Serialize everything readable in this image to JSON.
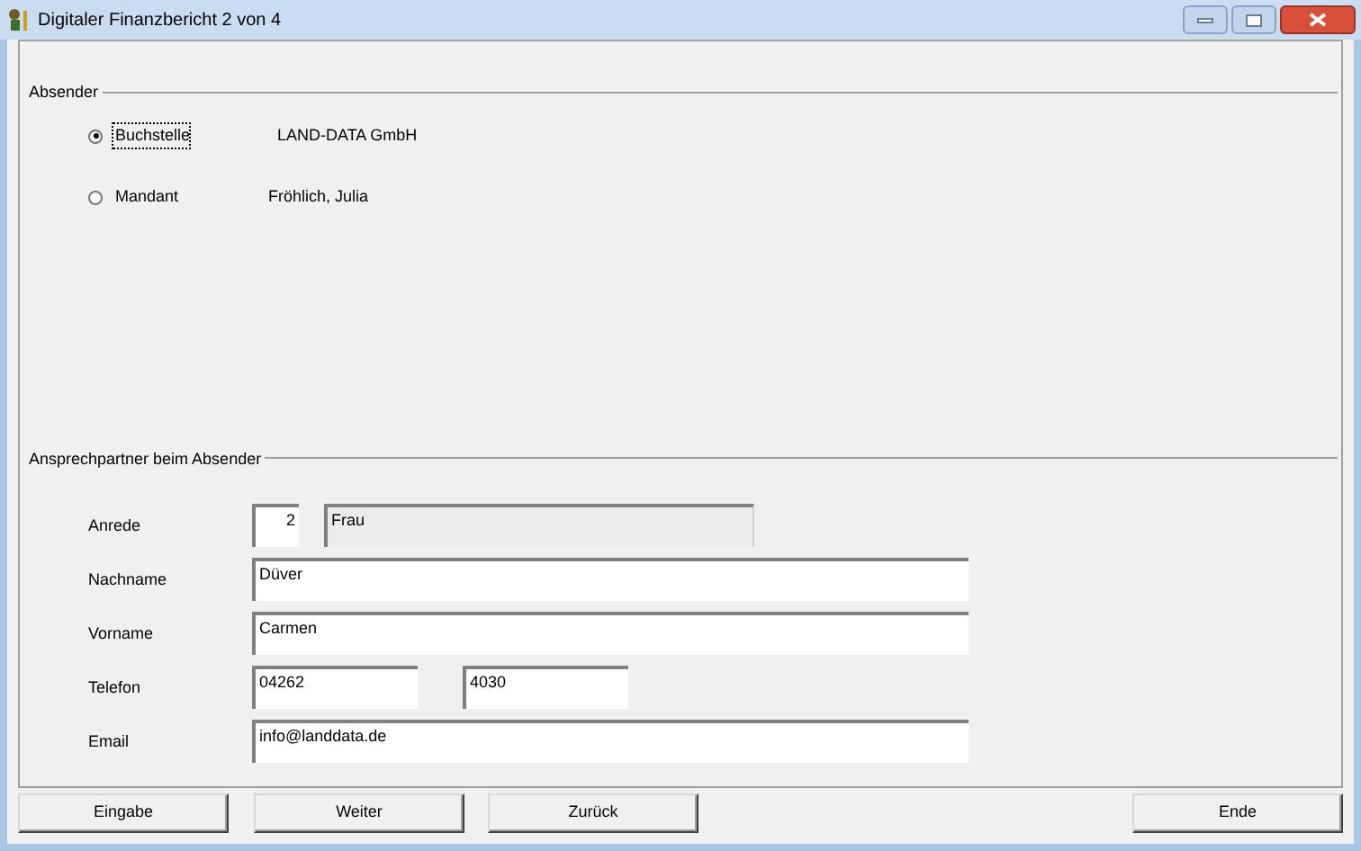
{
  "window": {
    "title": "Digitaler Finanzbericht 2 von 4"
  },
  "absender": {
    "title": "Absender",
    "options": [
      {
        "label": "Buchstelle",
        "value": "LAND-DATA GmbH",
        "selected": true
      },
      {
        "label": "Mandant",
        "value": "Fröhlich, Julia",
        "selected": false
      }
    ]
  },
  "ansprechpartner": {
    "title": "Ansprechpartner beim Absender",
    "fields": [
      {
        "label": "Anrede",
        "kind": "salutation",
        "code": "2",
        "value": "Frau"
      },
      {
        "label": "Nachname",
        "kind": "wide",
        "value": "Düver"
      },
      {
        "label": "Vorname",
        "kind": "wide",
        "value": "Carmen"
      },
      {
        "label": "Telefon",
        "kind": "phone",
        "value": "04262",
        "extension": "4030"
      },
      {
        "label": "Email",
        "kind": "wide",
        "value": "info@landdata.de"
      }
    ]
  },
  "buttons": [
    "Eingabe",
    "Weiter",
    "Zurück",
    "Ende"
  ]
}
